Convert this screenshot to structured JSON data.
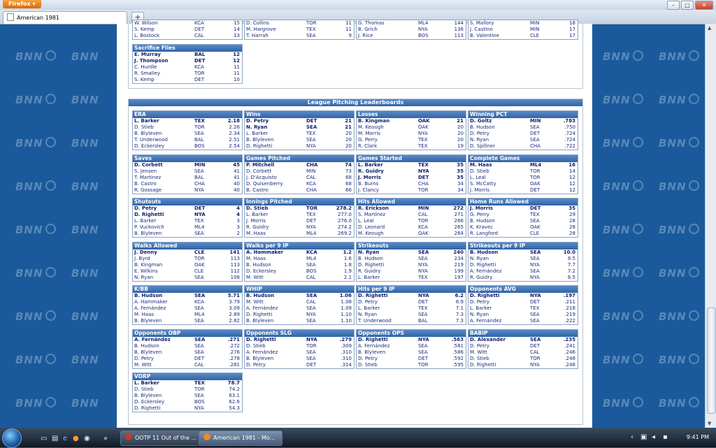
{
  "browser": {
    "menu_label": "Firefox",
    "tab_title": "American 1981",
    "new_tab_label": "+"
  },
  "watermark": "BNN",
  "batting": {
    "col1_rows": [
      {
        "name": "W. Wilson",
        "team": "KCA",
        "value": "15"
      },
      {
        "name": "S. Kemp",
        "team": "DET",
        "value": "14"
      },
      {
        "name": "L. Bostock",
        "team": "CAL",
        "value": "13"
      }
    ],
    "col2_rows": [
      {
        "name": "D. Collins",
        "team": "TOR",
        "value": "11"
      },
      {
        "name": "M. Hargrove",
        "team": "TEX",
        "value": "11"
      },
      {
        "name": "T. Harrah",
        "team": "SEA",
        "value": "9"
      }
    ],
    "col3_rows": [
      {
        "name": "G. Thomas",
        "team": "ML4",
        "value": "144"
      },
      {
        "name": "B. Grich",
        "team": "NYA",
        "value": "136"
      },
      {
        "name": "J. Rice",
        "team": "BOS",
        "value": "113"
      }
    ],
    "col4_rows": [
      {
        "name": "S. Mallory",
        "team": "MIN",
        "value": "18"
      },
      {
        "name": "J. Castino",
        "team": "MIN",
        "value": "17"
      },
      {
        "name": "B. Valentine",
        "team": "CLE",
        "value": "17"
      }
    ],
    "sacrifice_flies": {
      "title": "Sacrifice Flies",
      "rows": [
        {
          "name": "E. Murray",
          "team": "BAL",
          "value": "12"
        },
        {
          "name": "J. Thompson",
          "team": "DET",
          "value": "12"
        },
        {
          "name": "C. Hurdle",
          "team": "KCA",
          "value": "11"
        },
        {
          "name": "R. Smalley",
          "team": "TOR",
          "value": "11"
        },
        {
          "name": "S. Kemp",
          "team": "DET",
          "value": "10"
        }
      ]
    }
  },
  "pitching": {
    "header": "League Pitching Leaderboards",
    "boards": [
      {
        "title": "ERA",
        "rows": [
          {
            "name": "L. Barker",
            "team": "TEX",
            "value": "2.18"
          },
          {
            "name": "D. Stieb",
            "team": "TOR",
            "value": "2.26"
          },
          {
            "name": "B. Blyleven",
            "team": "SEA",
            "value": "2.34"
          },
          {
            "name": "T. Underwood",
            "team": "BAL",
            "value": "2.51"
          },
          {
            "name": "D. Eckersley",
            "team": "BOS",
            "value": "2.54"
          }
        ]
      },
      {
        "title": "Wins",
        "rows": [
          {
            "name": "D. Petry",
            "team": "DET",
            "value": "21"
          },
          {
            "name": "N. Ryan",
            "team": "SEA",
            "value": "21"
          },
          {
            "name": "L. Barker",
            "team": "TEX",
            "value": "20"
          },
          {
            "name": "B. Blyleven",
            "team": "SEA",
            "value": "20"
          },
          {
            "name": "D. Righetti",
            "team": "NYA",
            "value": "20"
          }
        ]
      },
      {
        "title": "Losses",
        "rows": [
          {
            "name": "B. Kingman",
            "team": "OAK",
            "value": "21"
          },
          {
            "name": "M. Keough",
            "team": "OAK",
            "value": "20"
          },
          {
            "name": "M. Morris",
            "team": "NYA",
            "value": "20"
          },
          {
            "name": "G. Perry",
            "team": "TEX",
            "value": "20"
          },
          {
            "name": "R. Clark",
            "team": "TEX",
            "value": "19"
          }
        ]
      },
      {
        "title": "Winning PCT",
        "rows": [
          {
            "name": "D. Goltz",
            "team": "MIN",
            "value": ".783"
          },
          {
            "name": "B. Hudson",
            "team": "SEA",
            "value": ".750"
          },
          {
            "name": "D. Petry",
            "team": "DET",
            "value": ".724"
          },
          {
            "name": "N. Ryan",
            "team": "SEA",
            "value": ".724"
          },
          {
            "name": "D. Spillner",
            "team": "CHA",
            "value": ".722"
          }
        ]
      },
      {
        "title": "Saves",
        "rows": [
          {
            "name": "D. Corbett",
            "team": "MIN",
            "value": "45"
          },
          {
            "name": "S. Jensen",
            "team": "SEA",
            "value": "41"
          },
          {
            "name": "T. Martinez",
            "team": "BAL",
            "value": "41"
          },
          {
            "name": "B. Castro",
            "team": "CHA",
            "value": "40"
          },
          {
            "name": "R. Gossage",
            "team": "NYA",
            "value": "40"
          }
        ]
      },
      {
        "title": "Games Pitched",
        "rows": [
          {
            "name": "P. Mitchell",
            "team": "CHA",
            "value": "74"
          },
          {
            "name": "D. Corbett",
            "team": "MIN",
            "value": "73"
          },
          {
            "name": "J. D'Acquisto",
            "team": "CAL",
            "value": "68"
          },
          {
            "name": "D. Quisenberry",
            "team": "KCA",
            "value": "68"
          },
          {
            "name": "B. Castro",
            "team": "CHA",
            "value": "66"
          }
        ]
      },
      {
        "title": "Games Started",
        "rows": [
          {
            "name": "L. Barker",
            "team": "TEX",
            "value": "35"
          },
          {
            "name": "R. Guidry",
            "team": "NYA",
            "value": "35"
          },
          {
            "name": "J. Morris",
            "team": "DET",
            "value": "35"
          },
          {
            "name": "B. Burns",
            "team": "CHA",
            "value": "34"
          },
          {
            "name": "J. Clancy",
            "team": "TOR",
            "value": "34"
          }
        ]
      },
      {
        "title": "Complete Games",
        "rows": [
          {
            "name": "M. Haas",
            "team": "ML4",
            "value": "16"
          },
          {
            "name": "D. Stieb",
            "team": "TOR",
            "value": "14"
          },
          {
            "name": "L. Leal",
            "team": "TOR",
            "value": "12"
          },
          {
            "name": "S. McCatty",
            "team": "OAK",
            "value": "12"
          },
          {
            "name": "J. Morris",
            "team": "DET",
            "value": "12"
          }
        ]
      },
      {
        "title": "Shutouts",
        "rows": [
          {
            "name": "D. Petry",
            "team": "DET",
            "value": "4"
          },
          {
            "name": "D. Righetti",
            "team": "NYA",
            "value": "4"
          },
          {
            "name": "L. Barker",
            "team": "TEX",
            "value": "3"
          },
          {
            "name": "P. Vuckovich",
            "team": "ML4",
            "value": "3"
          },
          {
            "name": "B. Blyleven",
            "team": "SEA",
            "value": "2"
          }
        ]
      },
      {
        "title": "Innings Pitched",
        "rows": [
          {
            "name": "D. Stieb",
            "team": "TOR",
            "value": "278.2"
          },
          {
            "name": "L. Barker",
            "team": "TEX",
            "value": "277.0"
          },
          {
            "name": "J. Morris",
            "team": "DET",
            "value": "276.0"
          },
          {
            "name": "R. Guidry",
            "team": "NYA",
            "value": "274.2"
          },
          {
            "name": "M. Haas",
            "team": "ML4",
            "value": "269.2"
          }
        ]
      },
      {
        "title": "Hits Allowed",
        "rows": [
          {
            "name": "R. Erickson",
            "team": "MIN",
            "value": "272"
          },
          {
            "name": "S. Martinez",
            "team": "CAL",
            "value": "271"
          },
          {
            "name": "L. Leal",
            "team": "TOR",
            "value": "266"
          },
          {
            "name": "D. Leonard",
            "team": "KCA",
            "value": "265"
          },
          {
            "name": "M. Keough",
            "team": "OAK",
            "value": "264"
          }
        ]
      },
      {
        "title": "Home Runs Allowed",
        "rows": [
          {
            "name": "J. Morris",
            "team": "DET",
            "value": "35"
          },
          {
            "name": "G. Perry",
            "team": "TEX",
            "value": "29"
          },
          {
            "name": "B. Hudson",
            "team": "SEA",
            "value": "28"
          },
          {
            "name": "K. Kravec",
            "team": "OAK",
            "value": "28"
          },
          {
            "name": "R. Langford",
            "team": "CLE",
            "value": "28"
          }
        ]
      },
      {
        "title": "Walks Allowed",
        "rows": [
          {
            "name": "J. Denny",
            "team": "CLE",
            "value": "141"
          },
          {
            "name": "J. Byrd",
            "team": "TOR",
            "value": "113"
          },
          {
            "name": "B. Kingman",
            "team": "OAK",
            "value": "113"
          },
          {
            "name": "E. Wilkins",
            "team": "CLE",
            "value": "112"
          },
          {
            "name": "N. Ryan",
            "team": "SEA",
            "value": "108"
          }
        ]
      },
      {
        "title": "Walks per 9 IP",
        "rows": [
          {
            "name": "A. Hammaker",
            "team": "KCA",
            "value": "1.2"
          },
          {
            "name": "M. Haas",
            "team": "ML4",
            "value": "1.6"
          },
          {
            "name": "B. Hudson",
            "team": "SEA",
            "value": "1.8"
          },
          {
            "name": "D. Eckersley",
            "team": "BOS",
            "value": "1.9"
          },
          {
            "name": "M. Witt",
            "team": "CAL",
            "value": "2.1"
          }
        ]
      },
      {
        "title": "Strikeouts",
        "rows": [
          {
            "name": "N. Ryan",
            "team": "SEA",
            "value": "240"
          },
          {
            "name": "B. Hudson",
            "team": "SEA",
            "value": "234"
          },
          {
            "name": "D. Righetti",
            "team": "NYA",
            "value": "219"
          },
          {
            "name": "R. Guidry",
            "team": "NYA",
            "value": "199"
          },
          {
            "name": "L. Barker",
            "team": "TEX",
            "value": "197"
          }
        ]
      },
      {
        "title": "Strikeouts per 9 IP",
        "rows": [
          {
            "name": "B. Hudson",
            "team": "SEA",
            "value": "10.0"
          },
          {
            "name": "N. Ryan",
            "team": "SEA",
            "value": "8.5"
          },
          {
            "name": "D. Righetti",
            "team": "NYA",
            "value": "7.7"
          },
          {
            "name": "A. Fernández",
            "team": "SEA",
            "value": "7.2"
          },
          {
            "name": "R. Guidry",
            "team": "NYA",
            "value": "6.5"
          }
        ]
      },
      {
        "title": "K/BB",
        "rows": [
          {
            "name": "B. Hudson",
            "team": "SEA",
            "value": "5.71"
          },
          {
            "name": "A. Hammaker",
            "team": "KCA",
            "value": "3.79"
          },
          {
            "name": "A. Fernández",
            "team": "SEA",
            "value": "3.09"
          },
          {
            "name": "M. Haas",
            "team": "ML4",
            "value": "2.89"
          },
          {
            "name": "B. Blyleven",
            "team": "SEA",
            "value": "2.82"
          }
        ]
      },
      {
        "title": "WHIP",
        "rows": [
          {
            "name": "B. Hudson",
            "team": "SEA",
            "value": "1.06"
          },
          {
            "name": "M. Witt",
            "team": "CAL",
            "value": "1.08"
          },
          {
            "name": "A. Fernández",
            "team": "SEA",
            "value": "1.09"
          },
          {
            "name": "D. Righetti",
            "team": "NYA",
            "value": "1.10"
          },
          {
            "name": "B. Blyleven",
            "team": "SEA",
            "value": "1.10"
          }
        ]
      },
      {
        "title": "Hits per 9 IP",
        "rows": [
          {
            "name": "D. Righetti",
            "team": "NYA",
            "value": "6.2"
          },
          {
            "name": "D. Petry",
            "team": "DET",
            "value": "6.9"
          },
          {
            "name": "L. Barker",
            "team": "TEX",
            "value": "7.1"
          },
          {
            "name": "N. Ryan",
            "team": "SEA",
            "value": "7.3"
          },
          {
            "name": "T. Underwood",
            "team": "BAL",
            "value": "7.3"
          }
        ]
      },
      {
        "title": "Opponents AVG",
        "rows": [
          {
            "name": "D. Righetti",
            "team": "NYA",
            "value": ".197"
          },
          {
            "name": "D. Petry",
            "team": "DET",
            "value": ".211"
          },
          {
            "name": "L. Barker",
            "team": "TEX",
            "value": ".218"
          },
          {
            "name": "N. Ryan",
            "team": "SEA",
            "value": ".219"
          },
          {
            "name": "A. Fernández",
            "team": "SEA",
            "value": ".222"
          }
        ]
      },
      {
        "title": "Opponents OBP",
        "rows": [
          {
            "name": "A. Fernández",
            "team": "SEA",
            "value": ".271"
          },
          {
            "name": "B. Hudson",
            "team": "SEA",
            "value": ".272"
          },
          {
            "name": "B. Blyleven",
            "team": "SEA",
            "value": ".276"
          },
          {
            "name": "D. Petry",
            "team": "DET",
            "value": ".278"
          },
          {
            "name": "M. Witt",
            "team": "CAL",
            "value": ".281"
          }
        ]
      },
      {
        "title": "Opponents SLG",
        "rows": [
          {
            "name": "D. Righetti",
            "team": "NYA",
            "value": ".279"
          },
          {
            "name": "D. Stieb",
            "team": "TOR",
            "value": ".309"
          },
          {
            "name": "A. Fernández",
            "team": "SEA",
            "value": ".310"
          },
          {
            "name": "B. Blyleven",
            "team": "SEA",
            "value": ".310"
          },
          {
            "name": "D. Petry",
            "team": "DET",
            "value": ".314"
          }
        ]
      },
      {
        "title": "Opponents OPS",
        "rows": [
          {
            "name": "D. Righetti",
            "team": "NYA",
            "value": ".563"
          },
          {
            "name": "A. Fernández",
            "team": "SEA",
            "value": ".581"
          },
          {
            "name": "B. Blyleven",
            "team": "SEA",
            "value": ".586"
          },
          {
            "name": "D. Petry",
            "team": "DET",
            "value": ".592"
          },
          {
            "name": "D. Stieb",
            "team": "TOR",
            "value": ".595"
          }
        ]
      },
      {
        "title": "BABIP",
        "rows": [
          {
            "name": "D. Alexander",
            "team": "SEA",
            "value": ".235"
          },
          {
            "name": "D. Petry",
            "team": "DET",
            "value": ".241"
          },
          {
            "name": "M. Witt",
            "team": "CAL",
            "value": ".246"
          },
          {
            "name": "D. Stieb",
            "team": "TOR",
            "value": ".248"
          },
          {
            "name": "D. Righetti",
            "team": "NYA",
            "value": ".248"
          }
        ]
      },
      {
        "title": "VORP",
        "rows": [
          {
            "name": "L. Barker",
            "team": "TEX",
            "value": "78.7"
          },
          {
            "name": "D. Stieb",
            "team": "TOR",
            "value": "74.2"
          },
          {
            "name": "B. Blyleven",
            "team": "SEA",
            "value": "63.1"
          },
          {
            "name": "D. Eckersley",
            "team": "BOS",
            "value": "62.6"
          },
          {
            "name": "D. Righetti",
            "team": "NYA",
            "value": "54.3"
          }
        ]
      }
    ]
  },
  "taskbar": {
    "tasks": [
      {
        "label": "OOTP 11 Out of the ..."
      },
      {
        "label": "American 1981 - Mo..."
      }
    ],
    "clock": "9:41 PM"
  }
}
